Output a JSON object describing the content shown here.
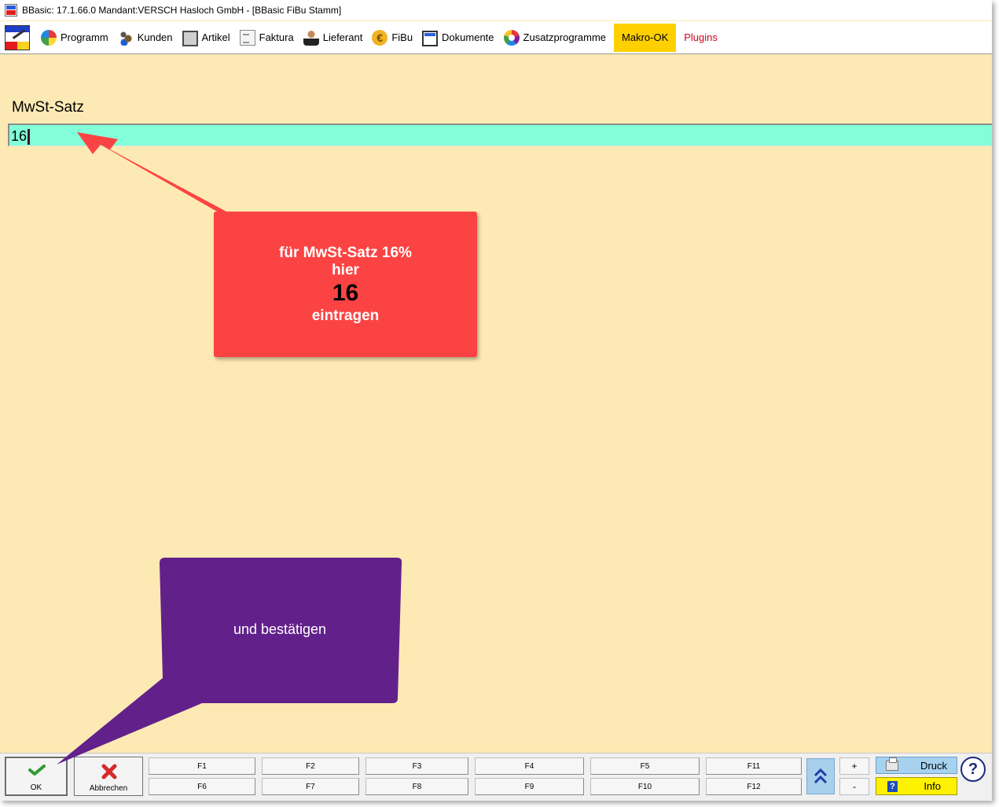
{
  "window": {
    "title": "BBasic: 17.1.66.0 Mandant:VERSCH Hasloch GmbH  - [BBasic FiBu Stamm]"
  },
  "menu": {
    "items": [
      {
        "label": "Programm",
        "icon": "programm-icon"
      },
      {
        "label": "Kunden",
        "icon": "kunden-icon"
      },
      {
        "label": "Artikel",
        "icon": "artikel-icon"
      },
      {
        "label": "Faktura",
        "icon": "faktura-icon"
      },
      {
        "label": "Lieferant",
        "icon": "lieferant-icon"
      },
      {
        "label": "FiBu",
        "icon": "fibu-icon"
      },
      {
        "label": "Dokumente",
        "icon": "dokumente-icon"
      },
      {
        "label": "Zusatzprogramme",
        "icon": "zusatzprogramme-icon"
      }
    ],
    "makro": "Makro-OK",
    "plugins": "Plugins",
    "colors": {
      "makro_bg": "#ffd000",
      "plugins_text": "#d0021b"
    }
  },
  "form": {
    "label": "MwSt-Satz",
    "value": "16",
    "input_bg": "#82ffd8",
    "page_bg": "#fde9b4"
  },
  "callouts": {
    "red": {
      "line1": "für MwSt-Satz 16%",
      "line2": "hier",
      "line3": "16",
      "line4": "eintragen",
      "color": "#fc4343"
    },
    "purple": {
      "text": "und bestätigen",
      "color": "#62218a"
    }
  },
  "bottom": {
    "ok": "OK",
    "cancel": "Abbrechen",
    "fkeys_row1": [
      "F1",
      "F2",
      "F3",
      "F4",
      "F5",
      "F11"
    ],
    "fkeys_row2": [
      "F6",
      "F7",
      "F8",
      "F9",
      "F10",
      "F12"
    ],
    "plus": "+",
    "minus": "-",
    "druck": "Druck",
    "info": "Info",
    "help": "?"
  }
}
